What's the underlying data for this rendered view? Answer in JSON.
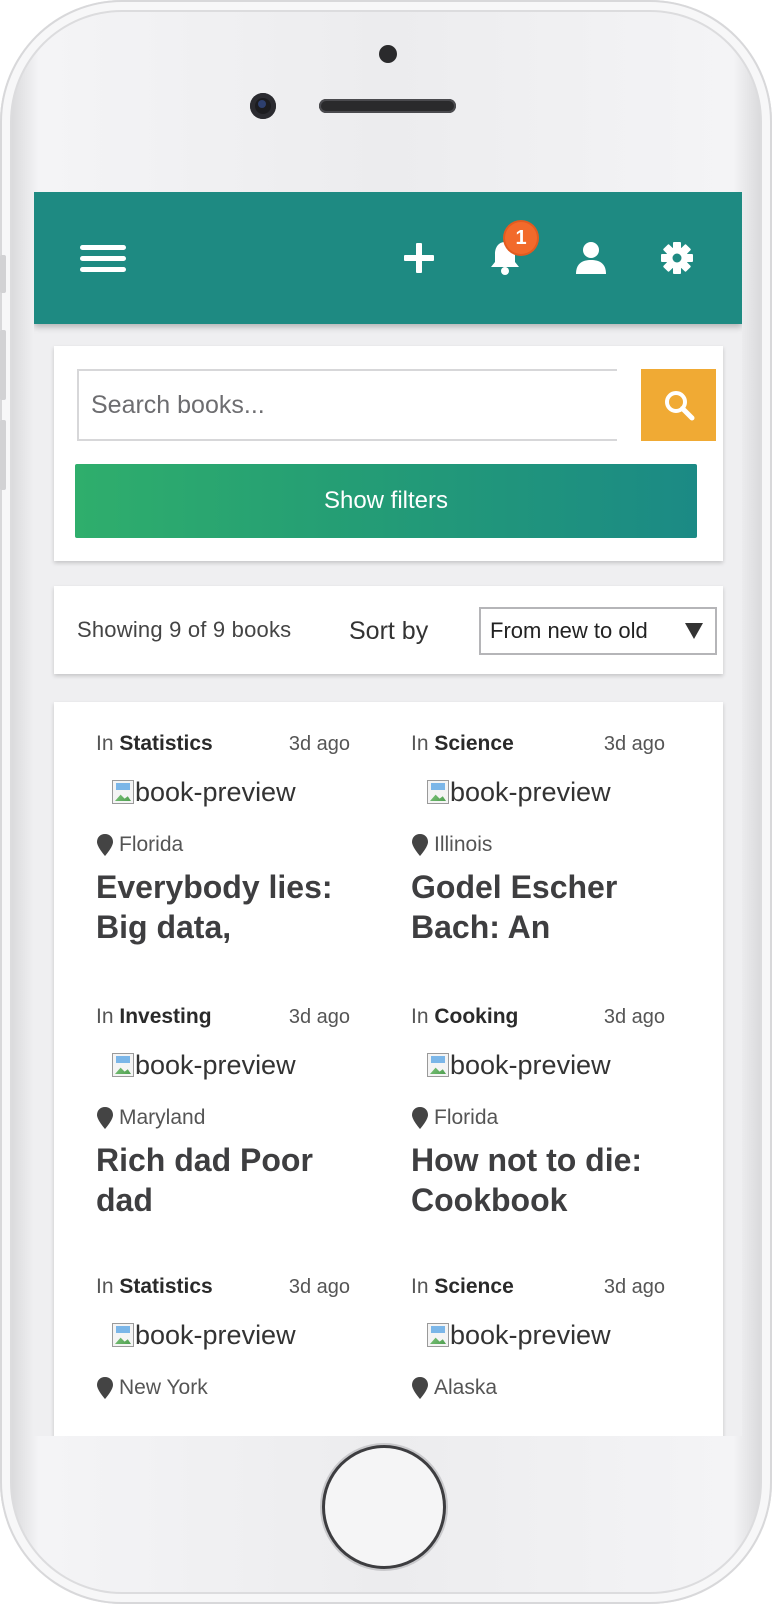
{
  "header": {
    "notification_count": "1",
    "accent_color": "#1e8a82"
  },
  "search": {
    "placeholder": "Search books...",
    "button_color": "#f0aa34"
  },
  "filters": {
    "button_label": "Show filters"
  },
  "results": {
    "showing_text": "Showing 9 of 9 books",
    "sort_label": "Sort by",
    "sort_selected": "From new to old"
  },
  "books": [
    {
      "in": "In",
      "category": "Statistics",
      "ago": "3d ago",
      "preview_alt": "book-preview",
      "location": "Florida",
      "title": "Everybody lies: Big data,"
    },
    {
      "in": "In",
      "category": "Science",
      "ago": "3d ago",
      "preview_alt": "book-preview",
      "location": "Illinois",
      "title": "Godel Escher Bach: An"
    },
    {
      "in": "In",
      "category": "Investing",
      "ago": "3d ago",
      "preview_alt": "book-preview",
      "location": "Maryland",
      "title": "Rich dad Poor dad"
    },
    {
      "in": "In",
      "category": "Cooking",
      "ago": "3d ago",
      "preview_alt": "book-preview",
      "location": "Florida",
      "title": "How not to die: Cookbook"
    },
    {
      "in": "In",
      "category": "Statistics",
      "ago": "3d ago",
      "preview_alt": "book-preview",
      "location": "New York",
      "title": ""
    },
    {
      "in": "In",
      "category": "Science",
      "ago": "3d ago",
      "preview_alt": "book-preview",
      "location": "Alaska",
      "title": ""
    }
  ],
  "icons": {
    "menu": "hamburger-icon",
    "add": "plus-icon",
    "notifications": "bell-icon",
    "profile": "user-icon",
    "settings": "gear-icon",
    "search": "search-icon",
    "location": "map-pin-icon",
    "dropdown": "caret-down-icon"
  }
}
